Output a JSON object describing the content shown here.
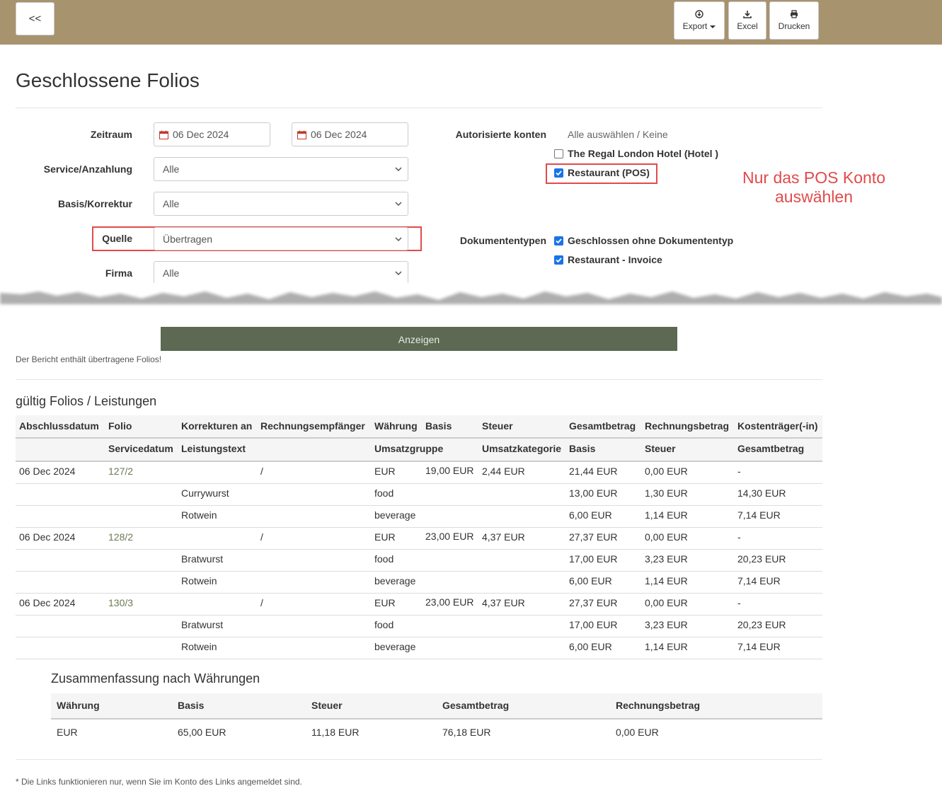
{
  "topbar": {
    "back_label": "<<",
    "export_label": "Export",
    "excel_label": "Excel",
    "print_label": "Drucken"
  },
  "page_title": "Geschlossene Folios",
  "filters": {
    "zeitraum_label": "Zeitraum",
    "date_from": "06 Dec 2024",
    "date_to": "06 Dec 2024",
    "service_label": "Service/Anzahlung",
    "service_value": "Alle",
    "basis_label": "Basis/Korrektur",
    "basis_value": "Alle",
    "quelle_label": "Quelle",
    "quelle_value": "Übertragen",
    "firma_label": "Firma",
    "firma_value": "Alle",
    "konten_label": "Autorisierte konten",
    "select_all": "Alle auswählen / Keine",
    "accounts": [
      {
        "label": "The Regal London Hotel (Hotel )",
        "checked": false
      },
      {
        "label": "Restaurant (POS)",
        "checked": true
      }
    ],
    "doc_label": "Dokumententypen",
    "doc_types": [
      {
        "label": "Geschlossen ohne Dokumententyp",
        "checked": true
      },
      {
        "label": "Restaurant - Invoice",
        "checked": true
      }
    ]
  },
  "annotation": {
    "line1": "Nur das POS Konto",
    "line2": "auswählen"
  },
  "show_button": "Anzeigen",
  "report_note": "Der Bericht enthält übertragene Folios!",
  "folios": {
    "title": "gültig Folios / Leistungen",
    "header1": [
      "Abschlussdatum",
      "Folio",
      "Korrekturen an",
      "Rechnungsempfänger",
      "Währung",
      "Basis",
      "Steuer",
      "Gesamtbetrag",
      "Rechnungsbetrag",
      "Kostenträger(-in)"
    ],
    "header2": [
      "Servicedatum",
      "Leistungstext",
      "Umsatzgruppe",
      "Umsatzkategorie",
      "Basis",
      "Steuer",
      "Gesamtbetrag"
    ],
    "rows": [
      {
        "kind": "folio",
        "date": "06 Dec 2024",
        "folio": "127/2",
        "recipient": "/",
        "currency": "EUR",
        "basis": "19,00 EUR",
        "tax": "2,44 EUR",
        "total": "21,44 EUR",
        "invoice": "0,00 EUR",
        "payer": "-"
      },
      {
        "kind": "item",
        "text": "Currywurst",
        "group": "food",
        "basis": "13,00 EUR",
        "tax": "1,30 EUR",
        "total": "14,30 EUR"
      },
      {
        "kind": "item",
        "text": "Rotwein",
        "group": "beverage",
        "basis": "6,00 EUR",
        "tax": "1,14 EUR",
        "total": "7,14 EUR"
      },
      {
        "kind": "folio",
        "date": "06 Dec 2024",
        "folio": "128/2",
        "recipient": "/",
        "currency": "EUR",
        "basis": "23,00 EUR",
        "tax": "4,37 EUR",
        "total": "27,37 EUR",
        "invoice": "0,00 EUR",
        "payer": "-"
      },
      {
        "kind": "item",
        "text": "Bratwurst",
        "group": "food",
        "basis": "17,00 EUR",
        "tax": "3,23 EUR",
        "total": "20,23 EUR"
      },
      {
        "kind": "item",
        "text": "Rotwein",
        "group": "beverage",
        "basis": "6,00 EUR",
        "tax": "1,14 EUR",
        "total": "7,14 EUR"
      },
      {
        "kind": "folio",
        "date": "06 Dec 2024",
        "folio": "130/3",
        "recipient": "/",
        "currency": "EUR",
        "basis": "23,00 EUR",
        "tax": "4,37 EUR",
        "total": "27,37 EUR",
        "invoice": "0,00 EUR",
        "payer": "-"
      },
      {
        "kind": "item",
        "text": "Bratwurst",
        "group": "food",
        "basis": "17,00 EUR",
        "tax": "3,23 EUR",
        "total": "20,23 EUR"
      },
      {
        "kind": "item",
        "text": "Rotwein",
        "group": "beverage",
        "basis": "6,00 EUR",
        "tax": "1,14 EUR",
        "total": "7,14 EUR"
      }
    ]
  },
  "summary": {
    "title": "Zusammenfassung nach Währungen",
    "headers": [
      "Währung",
      "Basis",
      "Steuer",
      "Gesamtbetrag",
      "Rechnungsbetrag"
    ],
    "row": [
      "EUR",
      "65,00 EUR",
      "11,18 EUR",
      "76,18 EUR",
      "0,00 EUR"
    ]
  },
  "footnote": "* Die Links funktionieren nur, wenn Sie im Konto des Links angemeldet sind."
}
